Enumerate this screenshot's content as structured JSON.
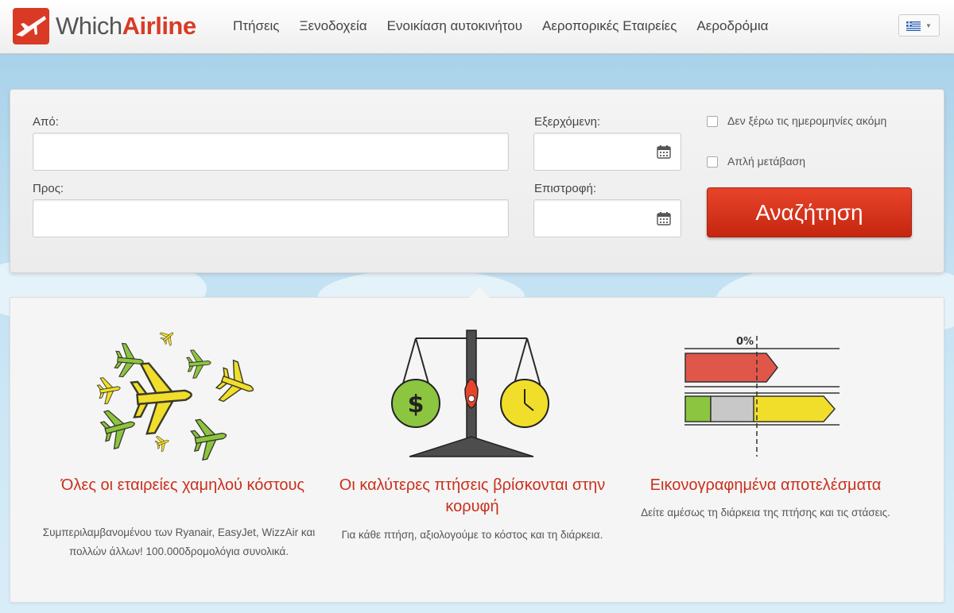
{
  "header": {
    "logo": {
      "which": "Which",
      "airline": "Airline"
    },
    "nav": [
      "Πτήσεις",
      "Ξενοδοχεία",
      "Ενοικίαση αυτοκινήτου",
      "Αεροπορικές Εταιρείες",
      "Αεροδρόμια"
    ],
    "language": {
      "selected": "greek-flag-icon"
    }
  },
  "search": {
    "from_label": "Από:",
    "from_value": "",
    "to_label": "Προς:",
    "to_value": "",
    "depart_label": "Εξερχόμενη:",
    "depart_value": "",
    "return_label": "Επιστροφή:",
    "return_value": "",
    "no_dates_label": "Δεν ξέρω τις ημερομηνίες ακόμη",
    "one_way_label": "Απλή μετάβαση",
    "search_button": "Αναζήτηση"
  },
  "features": [
    {
      "title": "Όλες οι εταιρείες χαμηλού κόστους",
      "desc": "Συμπεριλαμβανομένου των Ryanair, EasyJet, WizzAir και πολλών άλλων! 100.000δρομολόγια συνολικά."
    },
    {
      "title": "Οι καλύτερες πτήσεις βρίσκονται στην κορυφή",
      "desc": "Για κάθε πτήση, αξιολογούμε το κόστος και τη διάρκεια."
    },
    {
      "title": "Εικονογραφημένα αποτελέσματα",
      "desc": "Δείτε αμέσως τη διάρκεια της πτήσης και τις στάσεις."
    }
  ],
  "illustration": {
    "percent_label": "0%"
  },
  "colors": {
    "brand_red": "#d93a25",
    "plane_yellow": "#f1de2a",
    "plane_green": "#8cc540"
  }
}
